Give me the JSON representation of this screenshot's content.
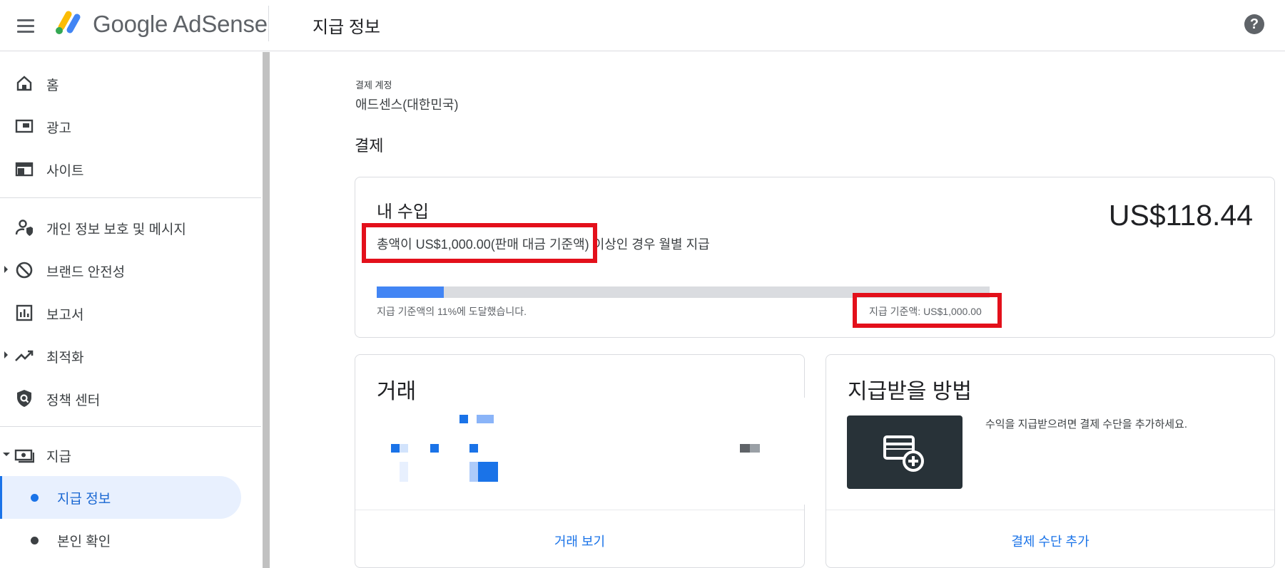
{
  "header": {
    "logo_text": "Google AdSense",
    "page_title": "지급 정보",
    "help_symbol": "?"
  },
  "sidebar": {
    "items": [
      {
        "label": "홈",
        "icon": "home-icon"
      },
      {
        "label": "광고",
        "icon": "ads-icon"
      },
      {
        "label": "사이트",
        "icon": "sites-icon"
      },
      {
        "label": "개인 정보 보호 및 메시지",
        "icon": "privacy-icon"
      },
      {
        "label": "브랜드 안전성",
        "icon": "block-icon"
      },
      {
        "label": "보고서",
        "icon": "report-icon"
      },
      {
        "label": "최적화",
        "icon": "trending-icon"
      },
      {
        "label": "정책 센터",
        "icon": "policy-icon"
      },
      {
        "label": "지급",
        "icon": "payments-icon"
      }
    ],
    "sub_items": [
      {
        "label": "지급 정보",
        "active": true
      },
      {
        "label": "본인 확인",
        "active": false
      }
    ]
  },
  "main": {
    "account_label": "결제 계정",
    "account_name": "애드센스(대한민국)",
    "section_title": "결제",
    "earnings": {
      "title": "내 수입",
      "amount": "US$118.44",
      "desc_highlighted": "총액이 US$1,000.00(판매 대금 기준액)",
      "desc_rest": " 이상인 경우 월별 지급",
      "progress_fraction": 0.11,
      "progress_note": "지급 기준액의 11%에 도달했습니다.",
      "threshold": "지급 기준액: US$1,000.00"
    },
    "transactions": {
      "title": "거래",
      "link": "거래 보기"
    },
    "payment_method": {
      "title": "지급받을 방법",
      "description": "수익을 지급받으려면 결제 수단을 추가하세요.",
      "link": "결제 수단 추가",
      "tile_icon": "add-card-icon"
    }
  },
  "colors": {
    "accent": "#1a73e8",
    "progress": "#4285f4",
    "highlight_box": "#e3101b",
    "tile_bg": "#283238"
  }
}
